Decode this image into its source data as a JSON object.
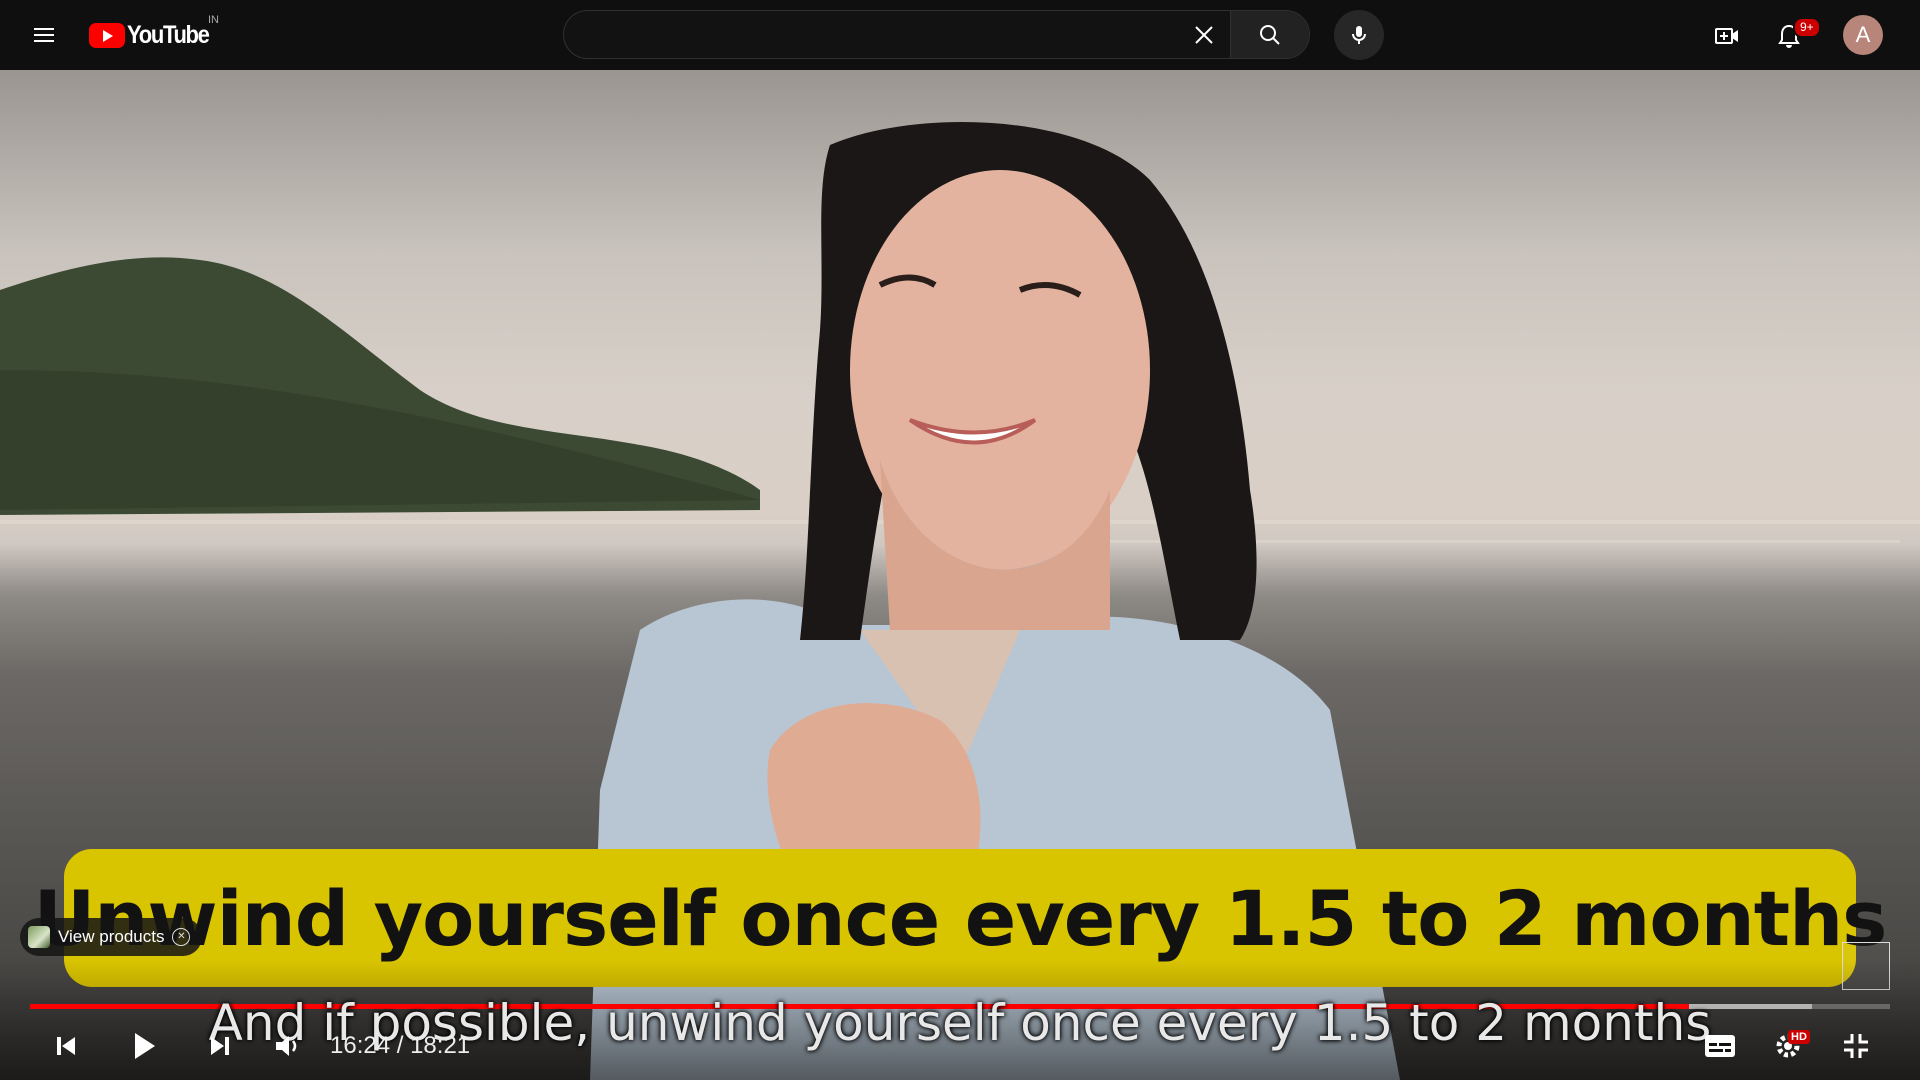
{
  "header": {
    "logo_text": "YouTube",
    "region": "IN",
    "search": {
      "value": "",
      "placeholder": ""
    },
    "notifications_badge": "9+",
    "avatar_letter": "A"
  },
  "video": {
    "caption_banner": "Unwind yourself once every 1.5 to 2 months",
    "subtitle": "And if possible, unwind yourself once every 1.5 to 2 months",
    "view_products_label": "View products",
    "progress": {
      "played_fraction": 0.892,
      "loaded_fraction": 0.958
    }
  },
  "player": {
    "current_time": "16:24",
    "duration": "18:21",
    "time_separator": " / ",
    "quality_badge": "HD"
  },
  "colors": {
    "brand_red": "#ff0000",
    "badge_red": "#cc0000",
    "caption_yellow": "#d9c400"
  },
  "icons": [
    "menu-icon",
    "youtube-logo-icon",
    "close-icon",
    "search-icon",
    "mic-icon",
    "create-icon",
    "bell-icon",
    "previous-icon",
    "play-icon",
    "next-icon",
    "volume-icon",
    "subtitles-icon",
    "settings-icon",
    "exit-fullscreen-icon"
  ]
}
